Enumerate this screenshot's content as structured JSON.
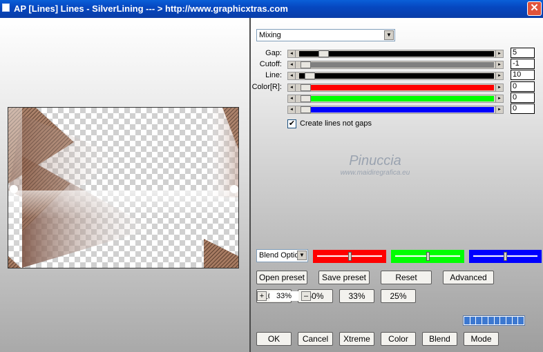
{
  "window": {
    "title": "AP [Lines]  Lines - SilverLining     --- > http://www.graphicxtras.com",
    "close_glyph": "✕"
  },
  "controls": {
    "mode_select": "Mixing",
    "dropdown_arrow": "▼"
  },
  "sliders": [
    {
      "label": "Gap:",
      "value": "5",
      "fill": "#000000"
    },
    {
      "label": "Cutoff:",
      "value": "-1",
      "fill": "#808080"
    },
    {
      "label": "Line:",
      "value": "10",
      "fill": "#000000"
    },
    {
      "label": "Color[R]:",
      "value": "0",
      "fill": "#ff0000"
    },
    {
      "label": "",
      "value": "0",
      "fill": "#00ff00"
    },
    {
      "label": "",
      "value": "0",
      "fill": "#0000ff"
    }
  ],
  "slider_arrows": {
    "left": "◄",
    "right": "►"
  },
  "checkbox": {
    "label": "Create lines not gaps",
    "checked": true,
    "mark": "✔"
  },
  "watermark": {
    "name": "Pinuccia",
    "site": "www.maidiregrafica.eu"
  },
  "blend": {
    "select": "Blend Optio",
    "colors": [
      "#ff0000",
      "#00ff00",
      "#0000ff"
    ]
  },
  "buttons": {
    "open_preset": "Open preset",
    "save_preset": "Save preset",
    "reset": "Reset",
    "advanced": "Advanced",
    "zoom_100": "100%",
    "zoom_50": "50%",
    "zoom_33": "33%",
    "zoom_25": "25%",
    "ok": "OK",
    "cancel": "Cancel",
    "xtreme": "Xtreme",
    "color": "Color",
    "blend": "Blend",
    "mode": "Mode"
  },
  "zoom": {
    "plus": "+",
    "minus": "–",
    "value": "33%"
  },
  "progress": {
    "segments": 10
  }
}
